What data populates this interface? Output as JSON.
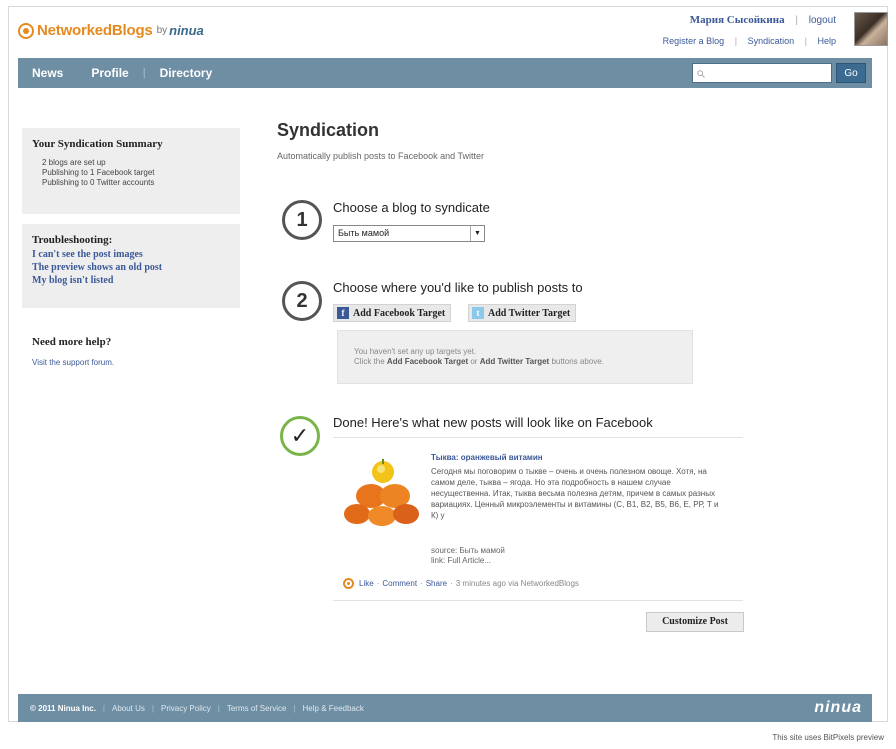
{
  "header": {
    "logo_main": "NetworkedBlogs",
    "logo_by": "by",
    "logo_brand": "ninua",
    "user_name": "Мария Сысойкина",
    "logout": "logout",
    "links": [
      "Register a Blog",
      "Syndication",
      "Help"
    ]
  },
  "nav": {
    "items": [
      "News",
      "Profile",
      "Directory"
    ],
    "search_placeholder": "",
    "go_label": "Go"
  },
  "sidebar": {
    "summary_title": "Your Syndication Summary",
    "summary_lines": [
      "2 blogs are set up",
      "Publishing to 1 Facebook target",
      "Publishing to 0 Twitter accounts"
    ],
    "troubleshooting_title": "Troubleshooting:",
    "troubleshooting_links": [
      "I can't see the post images",
      "The preview shows an old post",
      "My blog isn't listed"
    ],
    "help_title": "Need more help?",
    "help_link": "Visit the support forum."
  },
  "main": {
    "title": "Syndication",
    "subtitle": "Automatically publish posts to Facebook and Twitter",
    "step1": {
      "number": "1",
      "heading": "Choose a blog to syndicate",
      "select_value": "Быть мамой"
    },
    "step2": {
      "number": "2",
      "heading": "Choose where you'd like to publish posts to",
      "facebook_button": "Add Facebook Target",
      "twitter_button": "Add Twitter Target",
      "empty_line1": "You haven't set any up targets yet.",
      "empty_line2_prefix": "Click the",
      "empty_line2_fb": "Add Facebook Target",
      "empty_line2_or": "or",
      "empty_line2_tw": "Add Twitter Target",
      "empty_line2_suffix": "buttons above."
    },
    "step3": {
      "check": "✓",
      "heading": "Done! Here's what new posts will look like on Facebook",
      "post_title": "Тыква: оранжевый витамин",
      "post_text": "Сегодня мы поговорим о тыкве – очень и очень полезном овоще. Хотя, на самом деле, тыква – ягода. Но эта подробность в нашем случае несущественна. Итак, тыква весьма полезна детям, причем в самых разных вариациях. Ценный микроэлементы и витамины (С, В1, В2, В5, В6, Е, РР, Т и К) у",
      "post_source": "source: Быть мамой",
      "post_via": "link: Full Article...",
      "action_like": "Like",
      "action_comment": "Comment",
      "action_share": "Share",
      "action_time": "3 minutes ago via NetworkedBlogs",
      "customize_button": "Customize Post"
    }
  },
  "footer": {
    "copyright": "© 2011 Ninua Inc.",
    "links": [
      "About Us",
      "Privacy Policy",
      "Terms of Service",
      "Help & Feedback"
    ],
    "logo": "ninua",
    "note": "This site uses BitPixels preview"
  },
  "colors": {
    "nav_bg": "#6e8ea4",
    "brand_orange": "#e58a1f",
    "link_blue": "#3b5998",
    "done_green": "#7ab54a"
  }
}
